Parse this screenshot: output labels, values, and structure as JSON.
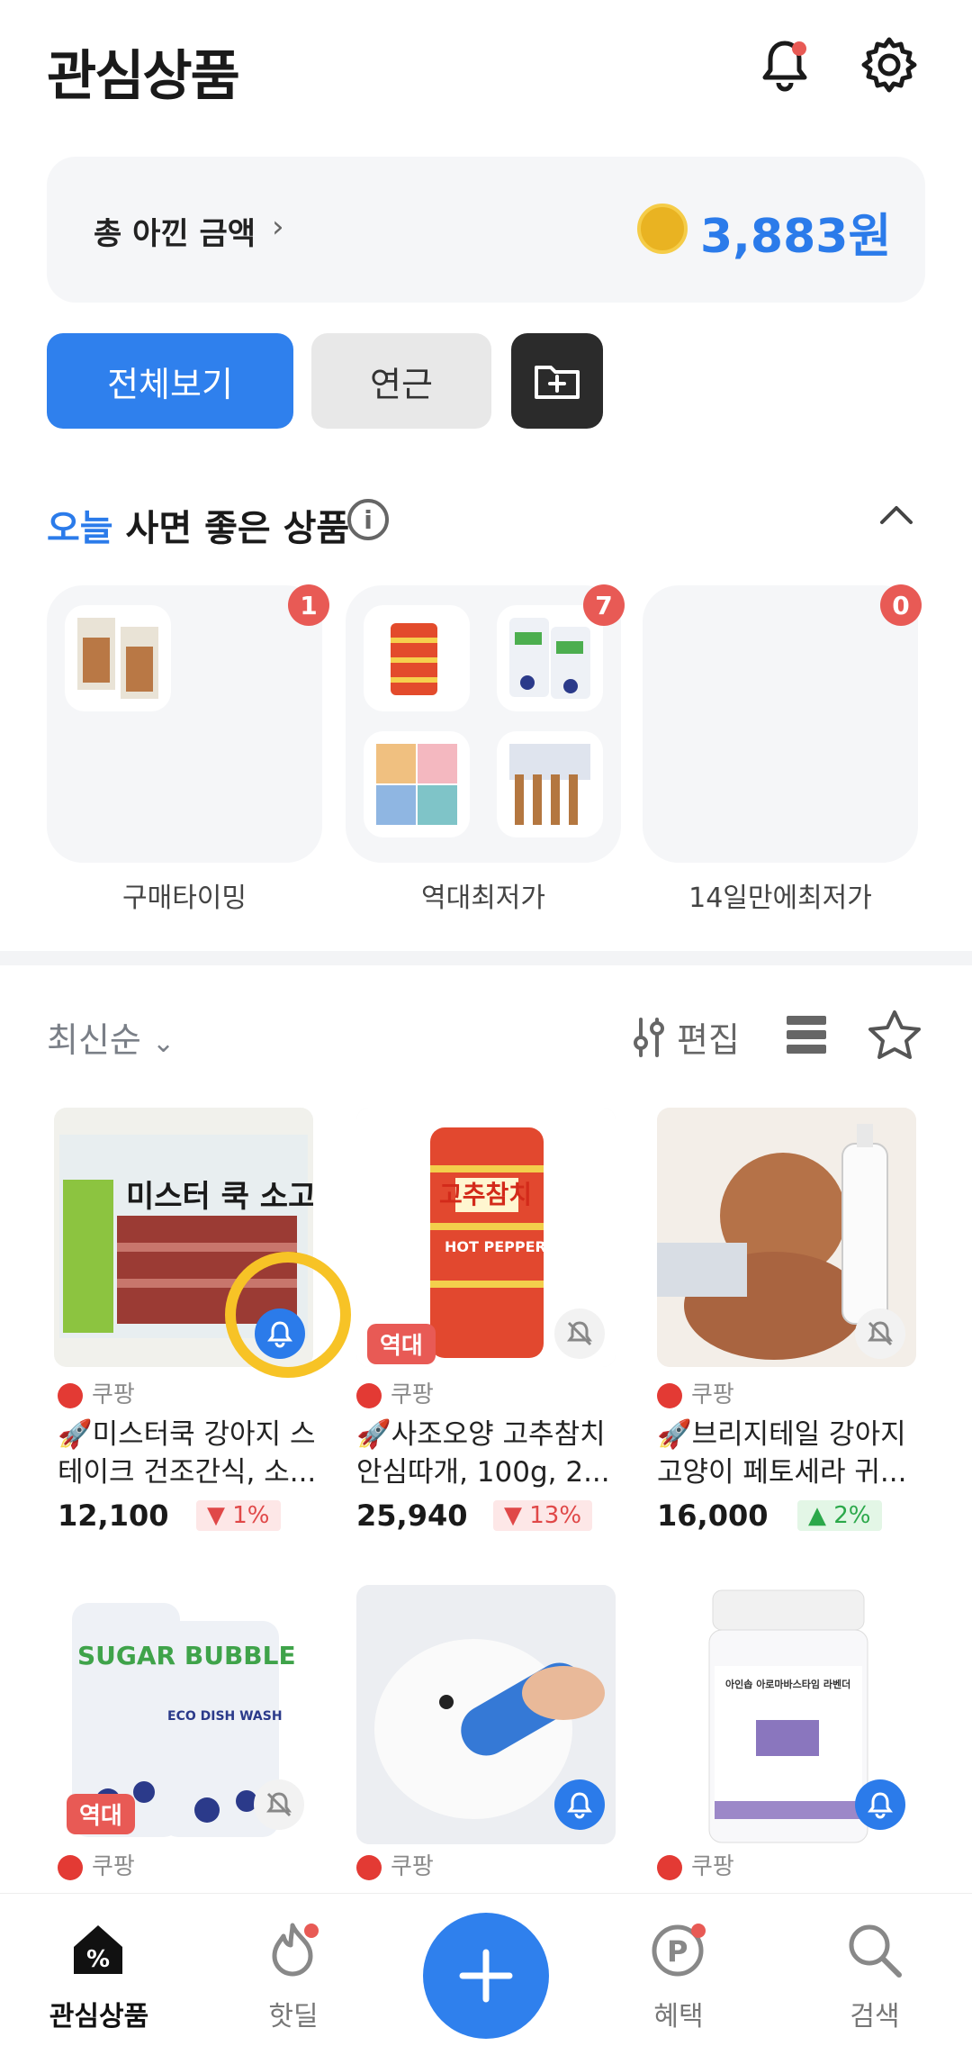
{
  "header": {
    "title": "관심상품"
  },
  "saved": {
    "label": "총 아낀 금액",
    "amount": "3,883원"
  },
  "filters": {
    "all": "전체보기",
    "year": "연근"
  },
  "section": {
    "highlight": "오늘",
    "title": "사면 좋은 상품"
  },
  "categories": [
    {
      "label": "구매타이밍",
      "count": "1"
    },
    {
      "label": "역대최저가",
      "count": "7"
    },
    {
      "label": "14일만에최저가",
      "count": "0"
    }
  ],
  "toolbar": {
    "sort": "최신순",
    "edit": "편집"
  },
  "products": [
    {
      "source": "쿠팡",
      "name": "🚀미스터쿡 강아지 스테이크 건조간식, 소...",
      "price": "12,100",
      "change": "▼ 1%",
      "bell": "on"
    },
    {
      "source": "쿠팡",
      "name": "🚀사조오양 고추참치 안심따개, 100g, 2...",
      "price": "25,940",
      "change": "▼ 13%",
      "tag": "역대",
      "bell": "off"
    },
    {
      "source": "쿠팡",
      "name": "🚀브리지테일 강아지 고양이 페토세라 귀...",
      "price": "16,000",
      "change": "▲ 2%",
      "bell": "off"
    },
    {
      "source": "쿠팡",
      "tag": "역대",
      "bell": "off"
    },
    {
      "source": "쿠팡",
      "bell": "on"
    },
    {
      "source": "쿠팡",
      "bell": "on"
    }
  ],
  "product_image_text": {
    "p1": "미스터 쿡 소고기",
    "p2": "고추참치",
    "p2_sub": "HOT PEPPER",
    "p4": "SUGAR BUBBLE",
    "p4_sub": "ECO DISH WASH",
    "p6": "아인솝 아로마바스타임 라벤더"
  },
  "nav": [
    {
      "label": "관심상품"
    },
    {
      "label": "핫딜"
    },
    {
      "label": ""
    },
    {
      "label": "혜택"
    },
    {
      "label": "검색"
    }
  ],
  "colors": {
    "accent": "#2b7bea",
    "badge": "#e85a55",
    "down": "#e04848",
    "up": "#2ba84a"
  }
}
